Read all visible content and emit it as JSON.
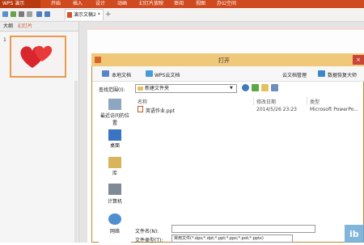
{
  "app": {
    "wps_button": "WPS 演示",
    "menu": [
      "开始",
      "插入",
      "设计",
      "动画",
      "幻灯片放映",
      "审阅",
      "视图",
      "办公空间"
    ]
  },
  "tabs": {
    "document_tab": "演示文稿2 *",
    "new_tab": "+"
  },
  "left_pane": {
    "tab_outline": "大纲",
    "tab_slides": "幻灯片",
    "slide_number": "1"
  },
  "dialog": {
    "title": "打开",
    "close": "×",
    "top_buttons": [
      "本地文档",
      "WPS云文档",
      "云文档管理",
      "数据恢复大师"
    ],
    "look_in_label": "查找范围(I):",
    "look_in_value": "新建文件夹",
    "places": [
      "最近访问的位置",
      "桌面",
      "库",
      "计算机",
      "网络"
    ],
    "columns": {
      "name": "名称",
      "date": "修改日期",
      "type": "类型"
    },
    "files": [
      {
        "name": "英语作业.ppt",
        "date": "2014/5/26 23:23",
        "type": "Microsoft PowerPo..."
      }
    ],
    "filename_label": "文件名(N):",
    "filename_value": "",
    "filetype_label": "文件类型(T):",
    "filetype_value": "常用文件(*.dps;*.dpt;*.ppt;*.pps;*.pot;*.pptx)"
  },
  "watermark": "ib",
  "colors": {
    "menubar": "#cf4a1f",
    "dialog_title": "#f0c87a",
    "accent": "#e89a50"
  }
}
